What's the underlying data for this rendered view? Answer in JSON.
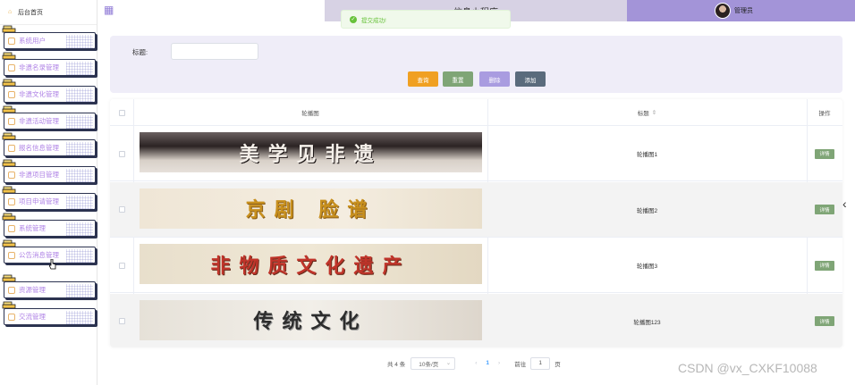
{
  "sidebar": {
    "home_label": "后台首页",
    "items": [
      {
        "label": "系统用户"
      },
      {
        "label": "非遗名录管理"
      },
      {
        "label": "非遗文化管理"
      },
      {
        "label": "非遗活动管理"
      },
      {
        "label": "报名信息管理"
      },
      {
        "label": "非遗项目管理"
      },
      {
        "label": "项目申请管理"
      },
      {
        "label": "系统管理"
      },
      {
        "label": "公告消息管理"
      },
      {
        "label": "资源管理"
      },
      {
        "label": "交流管理"
      }
    ]
  },
  "header": {
    "title": "信息小程序",
    "username": "管理员"
  },
  "toast": {
    "message": "提交成功!"
  },
  "search": {
    "title_label": "标题:",
    "title_value": "",
    "query_label": "查询",
    "reset_label": "重置",
    "delete_label": "删除",
    "add_label": "添加"
  },
  "table": {
    "headers": {
      "image": "轮播图",
      "title": "标题",
      "action": "操作"
    },
    "sort_icon": "sort-caret-icon",
    "rows": [
      {
        "title": "轮播图1",
        "banner_text": "美学见非遗",
        "action": "详情"
      },
      {
        "title": "轮播图2",
        "banner_text": "京剧 脸谱",
        "action": "详情"
      },
      {
        "title": "轮播图3",
        "banner_text": "非物质文化遗产",
        "action": "详情"
      },
      {
        "title": "轮播图123",
        "banner_text": "传统文化",
        "action": "详情"
      }
    ]
  },
  "pagination": {
    "total": "共 4 条",
    "page_size": "10条/页",
    "current_page": "1",
    "goto_label": "前往",
    "goto_value": "1",
    "page_unit": "页"
  },
  "watermark": "CSDN @vx_CXKF10088",
  "colors": {
    "accent_purple": "#a394d8",
    "title_band": "#d7d2e4",
    "panel_bg": "#efedf8",
    "query_btn": "#f0a022",
    "reset_btn": "#7fa576",
    "delete_btn": "#a99ce0",
    "add_btn": "#5a6b7c",
    "detail_btn": "#7fa576"
  }
}
